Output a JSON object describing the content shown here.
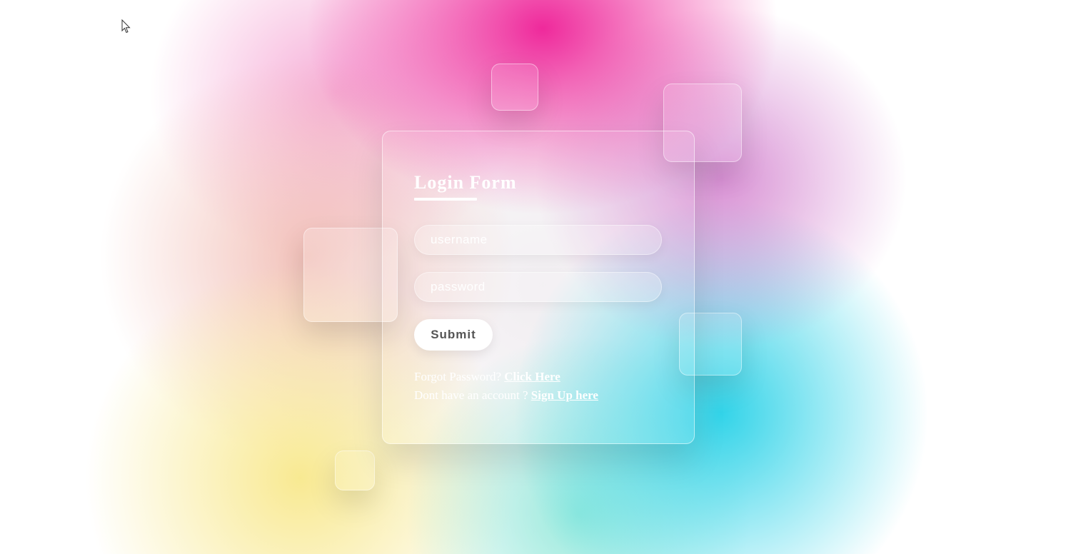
{
  "form": {
    "title": "Login Form",
    "username_placeholder": "username",
    "password_placeholder": "password",
    "submit_label": "Submit",
    "forgot_text": "Forgot Password?",
    "forgot_link": "Click Here",
    "signup_text": "Dont have an account ?",
    "signup_link": "Sign Up here"
  },
  "icons": {
    "cursor": "mouse-pointer-icon"
  },
  "colors": {
    "magenta": "#ee1e96",
    "cyan": "#28d2e8",
    "yellow": "#f8e88c",
    "text": "#ffffff",
    "button_text": "#555555"
  }
}
